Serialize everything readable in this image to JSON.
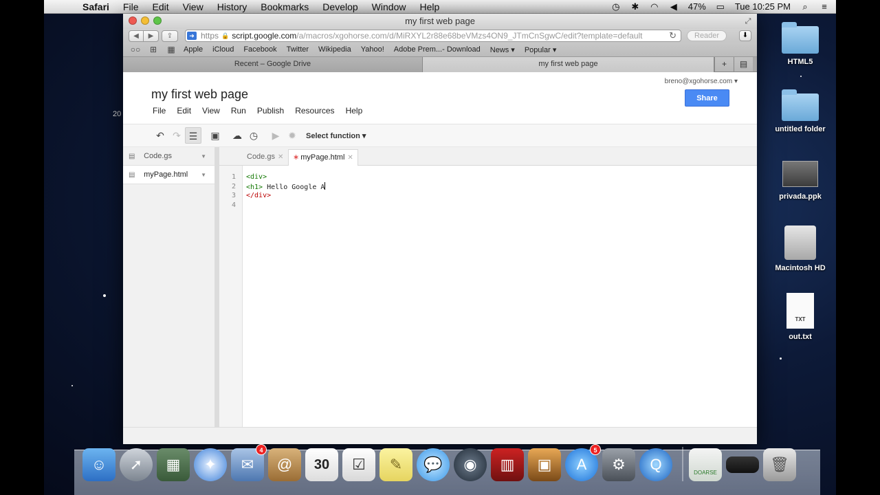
{
  "menubar": {
    "app": "Safari",
    "items": [
      "File",
      "Edit",
      "View",
      "History",
      "Bookmarks",
      "Develop",
      "Window",
      "Help"
    ],
    "battery": "47%",
    "clock": "Tue 10:25 PM"
  },
  "window": {
    "title": "my first web page",
    "url_scheme": "https",
    "url_host": "script.google.com",
    "url_path": "/a/macros/xgohorse.com/d/MiRXYL2r88e68beVMzs4ON9_JTmCnSgwC/edit?template=default",
    "reader": "Reader"
  },
  "bookmarks": [
    "Apple",
    "iCloud",
    "Facebook",
    "Twitter",
    "Wikipedia",
    "Yahoo!",
    "Adobe Prem...- Download",
    "News ▾",
    "Popular ▾"
  ],
  "browser_tabs": [
    "Recent – Google Drive",
    "my first web page"
  ],
  "app": {
    "project_title": "my first web page",
    "menu": [
      "File",
      "Edit",
      "View",
      "Run",
      "Publish",
      "Resources",
      "Help"
    ],
    "account": "breno@xgohorse.com ▾",
    "share": "Share",
    "select_function": "Select function ▾"
  },
  "files": [
    {
      "name": "Code.gs",
      "selected": false
    },
    {
      "name": "myPage.html",
      "selected": true
    }
  ],
  "editor_tabs": [
    {
      "name": "Code.gs",
      "modified": false
    },
    {
      "name": "myPage.html",
      "modified": true
    }
  ],
  "code": {
    "line_numbers": [
      "1",
      "2",
      "3",
      "4"
    ],
    "line1": "<div>",
    "line2_tag": "<h1>",
    "line2_text": " Hello Google A",
    "line3": "</div>"
  },
  "desktop": {
    "icons": [
      "HTML5",
      "untitled folder",
      "privada.ppk",
      "Macintosh HD",
      "out.txt"
    ],
    "side_text": "20"
  },
  "dock": {
    "calendar_day": "30",
    "mail_badge": "4",
    "appstore_badge": "5",
    "doarse_label": "DOARSE"
  }
}
